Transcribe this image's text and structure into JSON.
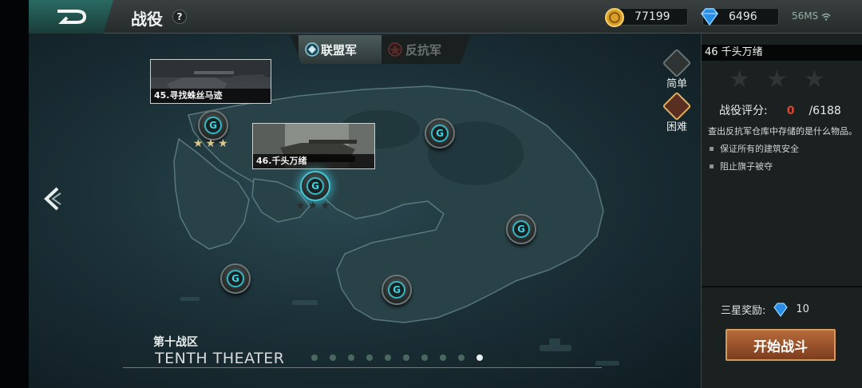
{
  "header": {
    "title": "战役",
    "help_label": "?",
    "gold": "77199",
    "diamonds": "6496",
    "network": "56MS"
  },
  "factions": {
    "allied_label": "联盟军",
    "rebel_label": "反抗军",
    "selected": "allied"
  },
  "map": {
    "missions": [
      {
        "number": 45,
        "name": "45.寻找蛛丝马迹",
        "stars_earned": 3
      },
      {
        "number": 46,
        "name": "46.千头万绪",
        "stars_earned": 0,
        "current": true
      }
    ],
    "difficulty": {
      "easy_label": "简单",
      "hard_label": "困难",
      "selected": "hard"
    },
    "theater": {
      "cn": "第十战区",
      "en": "TENTH THEATER"
    },
    "pagination": {
      "total": 10,
      "active_page": 10
    }
  },
  "panel": {
    "mission_header": "46  千头万绪",
    "stars_max": 3,
    "stars_earned": 0,
    "score_label": "战役评分:",
    "score_current": "0",
    "score_max": "/6188",
    "description": "查出反抗军仓库中存储的是什么物品。",
    "objectives": [
      "保证所有的建筑安全",
      "阻止旗子被夺"
    ],
    "reward_label": "三星奖励:",
    "reward_amount": "10",
    "start_button": "开始战斗"
  },
  "colors": {
    "accent_cyan": "#33b8c6",
    "score_red": "#e0442e",
    "button_orange": "#b66a3a",
    "star_gold": "#d9c88c"
  }
}
